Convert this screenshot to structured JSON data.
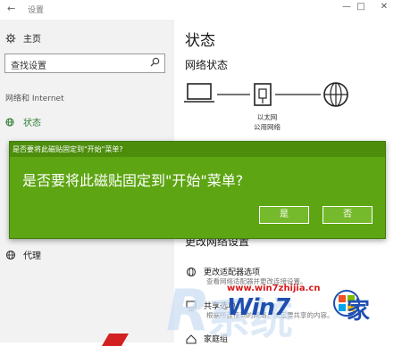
{
  "titlebar": {
    "back_glyph": "←",
    "title": "设置",
    "minimize": "—",
    "maximize": "□",
    "close": "✕"
  },
  "sidebar": {
    "home_label": "主页",
    "search_placeholder": "查找设置",
    "section_label": "网络和 Internet",
    "items": [
      {
        "label": "状态",
        "icon": "globe-ethernet-icon",
        "active": true
      },
      {
        "label": "代理",
        "icon": "globe-icon",
        "active": false
      }
    ]
  },
  "main": {
    "title": "状态",
    "network_status_title": "网络状态",
    "network_label_line1": "以太网",
    "network_label_line2": "公用网络",
    "partial_heading": "更改网络设置",
    "settings": [
      {
        "title": "更改适配器选项",
        "desc": "查看网络适配器并更改连接设置。"
      },
      {
        "title": "共享选项",
        "desc": "根据所连接到的网络，决定要共享的内容。"
      },
      {
        "title": "家庭组",
        "desc": ""
      }
    ]
  },
  "dialog": {
    "caption": "是否要将此磁贴固定到\"开始\"菜单?",
    "question": "是否要将此磁贴固定到\"开始\"菜单?",
    "yes_label": "是",
    "no_label": "否"
  },
  "watermark": {
    "url": "www.win7zhijia.cn",
    "logo": "Win7",
    "logo_suffix": "家"
  },
  "colors": {
    "accent_green": "#5da512",
    "status_green": "#2e7d32",
    "sidebar_bg": "#f2f2f2"
  }
}
